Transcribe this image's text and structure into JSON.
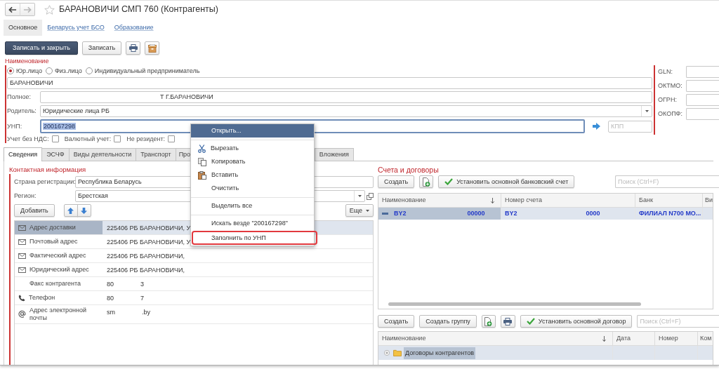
{
  "window": {
    "title": "БАРАНОВИЧИ СМП 760 (Контрагенты)"
  },
  "navigation": [
    {
      "kind": "back",
      "disabled": false
    },
    {
      "kind": "forward",
      "disabled": true
    }
  ],
  "favorite": {
    "on": false
  },
  "sections": [
    {
      "label": "Основное",
      "selected": true
    },
    {
      "label": "Беларусь учет БСО",
      "selected": false
    },
    {
      "label": "Образование",
      "selected": false
    }
  ],
  "command_bar": [
    {
      "kind": "primary",
      "label": "Записать и закрыть"
    },
    {
      "kind": "default",
      "label": "Записать"
    },
    {
      "kind": "print"
    },
    {
      "kind": "box"
    }
  ],
  "name_group": {
    "title": "Наименование",
    "legal_forms": [
      {
        "label": "Юр.лицо",
        "selected": true
      },
      {
        "label": "Физ.лицо",
        "selected": false
      },
      {
        "label": "Индивидуальный предприниматель",
        "selected": false
      }
    ],
    "short_name": "БАРАНОВИЧИ",
    "fields": [
      {
        "kind": "text",
        "label": "Полное:",
        "value": "Т Г.БАРАНОВИЧИ"
      },
      {
        "kind": "select",
        "label": "Родитель:",
        "value": "Юридические лица РБ"
      }
    ],
    "unp": {
      "label": "УНП:",
      "value": "200167298",
      "focused": true
    },
    "kpp": {
      "placeholder": "КПП"
    },
    "flags": [
      {
        "label": "Учет без НДС:",
        "checked": false
      },
      {
        "label": "Валютный учет:",
        "checked": false
      },
      {
        "label": "Не резидент:",
        "checked": false
      }
    ]
  },
  "codes": [
    {
      "label": "GLN:"
    },
    {
      "label": "ОКТМО:"
    },
    {
      "label": "ОГРН:"
    },
    {
      "label": "ОКОПФ:"
    }
  ],
  "tabs": [
    {
      "label": "Сведения",
      "selected": true,
      "covered": false
    },
    {
      "label": "ЭСЧФ",
      "selected": false,
      "covered": false
    },
    {
      "label": "Виды деятельности",
      "selected": false,
      "covered": false
    },
    {
      "label": "Транспорт",
      "selected": false,
      "covered": false
    },
    {
      "label": "Про",
      "selected": false,
      "covered": true
    },
    {
      "label": "Вложения",
      "selected": false,
      "covered": false
    }
  ],
  "contacts": {
    "title": "Контактная информация",
    "fields": [
      {
        "kind": "text",
        "label": "Страна регистрации:",
        "value": "Республика Беларусь"
      },
      {
        "kind": "select",
        "label": "Регион:",
        "value": "Брестская"
      }
    ],
    "add_button": "Добавить",
    "more_button": "Еще",
    "rows": [
      {
        "kind": "address",
        "label": "Адрес доставки",
        "value": "225406 РБ БАРАНОВИЧИ, У",
        "selected": true
      },
      {
        "kind": "address",
        "label": "Почтовый адрес",
        "value": "225406 РБ БАРАНОВИЧИ, У",
        "selected": false
      },
      {
        "kind": "address",
        "label": "Фактический адрес",
        "value": "225406 РБ БАРАНОВИЧИ,",
        "selected": false
      },
      {
        "kind": "address",
        "label": "Юридический адрес",
        "value": "225406 РБ БАРАНОВИЧИ,",
        "selected": false
      },
      {
        "kind": "fax",
        "label": "Факс контрагента",
        "value_parts": [
          "80",
          "3"
        ],
        "selected": false
      },
      {
        "kind": "phone",
        "label": "Телефон",
        "value_parts": [
          "80",
          "7"
        ],
        "selected": false
      },
      {
        "kind": "email",
        "label": "Адрес электронной почты",
        "value_parts": [
          "sm",
          ".by"
        ],
        "selected": false
      }
    ]
  },
  "accounts": {
    "title": "Счета и договоры",
    "toolbar": {
      "create": "Создать",
      "set_main": "Установить основной банковский счет",
      "search_placeholder": "Поиск (Ctrl+F)"
    },
    "columns": [
      {
        "label": "Наименование",
        "sorted": true
      },
      {
        "label": "Номер счета",
        "sorted": false
      },
      {
        "label": "Банк",
        "sorted": false
      },
      {
        "label": "Ви",
        "sorted": false
      }
    ],
    "rows": [
      {
        "selected": true,
        "name_parts": [
          "BY2",
          "00000"
        ],
        "number_parts": [
          "BY2",
          "0000"
        ],
        "bank": "ФИЛИАЛ N700 МО..."
      }
    ]
  },
  "contracts": {
    "toolbar": {
      "create": "Создать",
      "create_group": "Создать группу",
      "set_main": "Установить основной договор",
      "search_placeholder": "Поиск (Ctrl+F)"
    },
    "columns": [
      {
        "label": "Наименование",
        "sorted": true
      },
      {
        "label": "Дата",
        "sorted": false
      },
      {
        "label": "Номер",
        "sorted": false
      },
      {
        "label": "Ком",
        "sorted": false
      }
    ],
    "rows": [
      {
        "kind": "group",
        "name": "Договоры контрагентов",
        "selected": true,
        "expanded": false
      }
    ]
  },
  "context_menu": {
    "items": [
      {
        "kind": "command",
        "label": "Открыть...",
        "selected": true,
        "outlined": false
      },
      {
        "kind": "separator"
      },
      {
        "kind": "cut",
        "label": "Вырезать",
        "selected": false,
        "outlined": false
      },
      {
        "kind": "copy",
        "label": "Копировать",
        "selected": false,
        "outlined": false
      },
      {
        "kind": "paste",
        "label": "Вставить",
        "selected": false,
        "outlined": false
      },
      {
        "kind": "command",
        "label": "Очистить",
        "selected": false,
        "outlined": false
      },
      {
        "kind": "separator"
      },
      {
        "kind": "command",
        "label": "Выделить все",
        "selected": false,
        "outlined": false
      },
      {
        "kind": "separator"
      },
      {
        "kind": "command",
        "label": "Искать везде \"200167298\"",
        "selected": false,
        "outlined": false
      },
      {
        "kind": "command",
        "label": "Заполнить по УНП",
        "selected": false,
        "outlined": true
      }
    ]
  }
}
